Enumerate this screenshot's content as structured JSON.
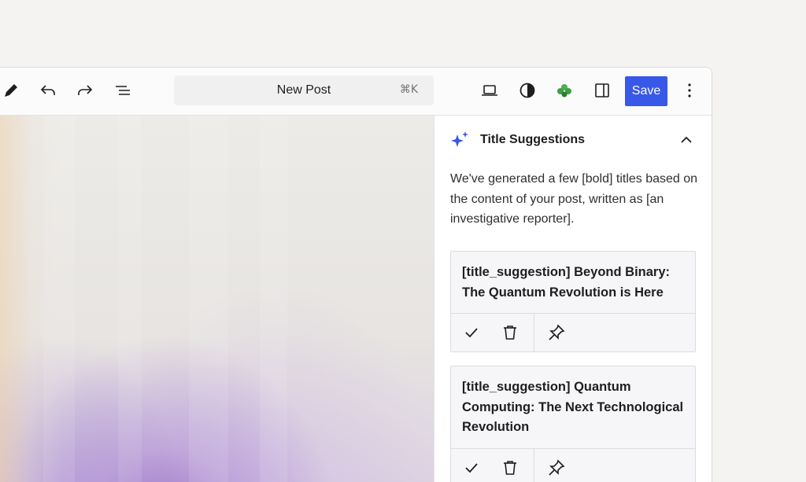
{
  "toolbar": {
    "icons": [
      "pencil-icon",
      "undo-icon",
      "redo-icon",
      "list-view-icon",
      "desktop-preview-icon",
      "contrast-icon",
      "plugin-leaf-icon",
      "sidebar-toggle-icon",
      "more-options-icon"
    ],
    "command_label": "New Post",
    "shortcut": "⌘K",
    "save_label": "Save",
    "accent_color": "#3858e9",
    "plugin_color": "#4caf50"
  },
  "panel": {
    "icon": "sparkles-icon",
    "title": "Title Suggestions",
    "description": "We've generated a few [bold] titles based on the content of your post, written as [an investigative reporter].",
    "suggestions": [
      {
        "title": "[title_suggestion] Beyond Binary: The Quantum Revolution is Here"
      },
      {
        "title": "[title_suggestion] Quantum Computing: The Next Technological Revolution"
      }
    ],
    "action_icons": [
      "check-icon",
      "trash-icon",
      "pin-icon"
    ]
  }
}
